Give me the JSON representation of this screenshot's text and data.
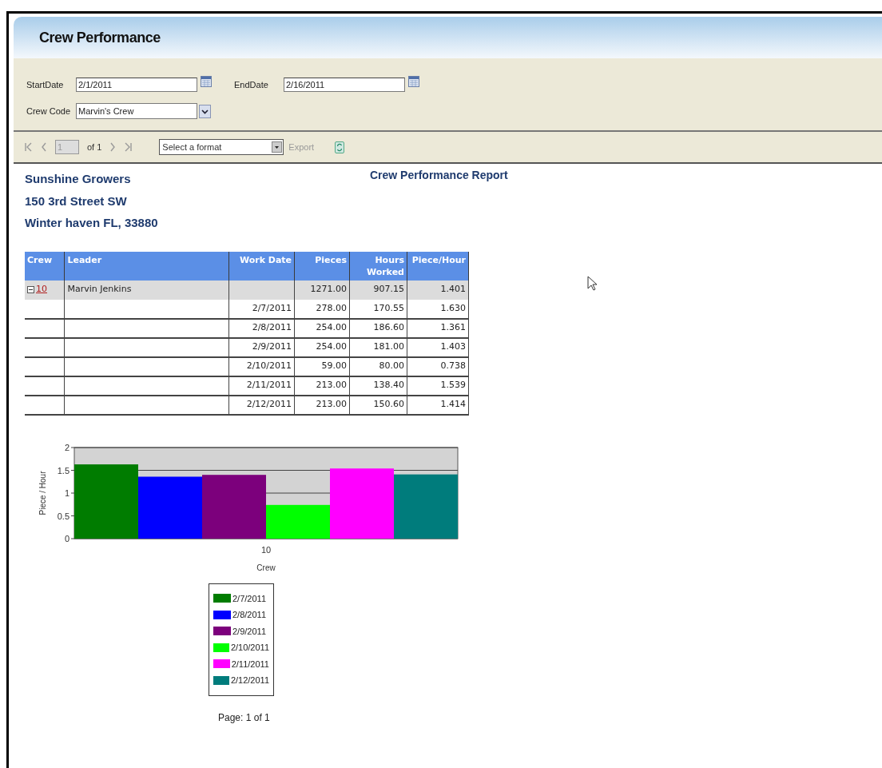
{
  "window": {
    "title": "Crew Performance"
  },
  "filters": [
    {
      "kind": "date",
      "label": "StartDate",
      "value": "2/1/2011"
    },
    {
      "kind": "date",
      "label": "EndDate",
      "value": "2/16/2011"
    },
    {
      "kind": "select",
      "label": "Crew Code",
      "value": "Marvin's Crew"
    }
  ],
  "toolbar": {
    "page": "1",
    "page_count": "of 1",
    "format": "Select a format",
    "export": "Export"
  },
  "report": {
    "address": [
      "Sunshine Growers",
      "150 3rd Street SW",
      "Winter haven FL, 33880"
    ],
    "title": "Crew Performance Report",
    "columns": [
      "Crew",
      "Leader",
      "Work Date",
      "Pieces",
      "Hours Worked",
      "Piece/Hour"
    ],
    "rows": [
      {
        "kind": "group",
        "expanded": true,
        "cells": [
          "10",
          "Marvin Jenkins",
          "",
          "1271.00",
          "907.15",
          "1.401"
        ]
      },
      {
        "kind": "detail",
        "cells": [
          "",
          "",
          "2/7/2011",
          "278.00",
          "170.55",
          "1.630"
        ]
      },
      {
        "kind": "detail",
        "cells": [
          "",
          "",
          "2/8/2011",
          "254.00",
          "186.60",
          "1.361"
        ]
      },
      {
        "kind": "detail",
        "cells": [
          "",
          "",
          "2/9/2011",
          "254.00",
          "181.00",
          "1.403"
        ]
      },
      {
        "kind": "detail",
        "cells": [
          "",
          "",
          "2/10/2011",
          "59.00",
          "80.00",
          "0.738"
        ]
      },
      {
        "kind": "detail",
        "cells": [
          "",
          "",
          "2/11/2011",
          "213.00",
          "138.40",
          "1.539"
        ]
      },
      {
        "kind": "detail",
        "cells": [
          "",
          "",
          "2/12/2011",
          "213.00",
          "150.60",
          "1.414"
        ]
      }
    ],
    "chart_data": {
      "type": "bar",
      "xlabel": "Crew",
      "ylabel": "Piece / Hour",
      "categories": [
        "10"
      ],
      "ylim": [
        0,
        2
      ],
      "yticks": [
        0,
        0.5,
        1,
        1.5,
        2
      ],
      "series": [
        {
          "name": "2/7/2011",
          "color": "#007c00",
          "values": [
            1.63
          ]
        },
        {
          "name": "2/8/2011",
          "color": "#0000ff",
          "values": [
            1.36
          ]
        },
        {
          "name": "2/9/2011",
          "color": "#7c007c",
          "values": [
            1.4
          ]
        },
        {
          "name": "2/10/2011",
          "color": "#00ff00",
          "values": [
            0.74
          ]
        },
        {
          "name": "2/11/2011",
          "color": "#ff00ff",
          "values": [
            1.54
          ]
        },
        {
          "name": "2/12/2011",
          "color": "#007c7c",
          "values": [
            1.41
          ]
        }
      ]
    },
    "footer": "Page: 1 of 1"
  }
}
